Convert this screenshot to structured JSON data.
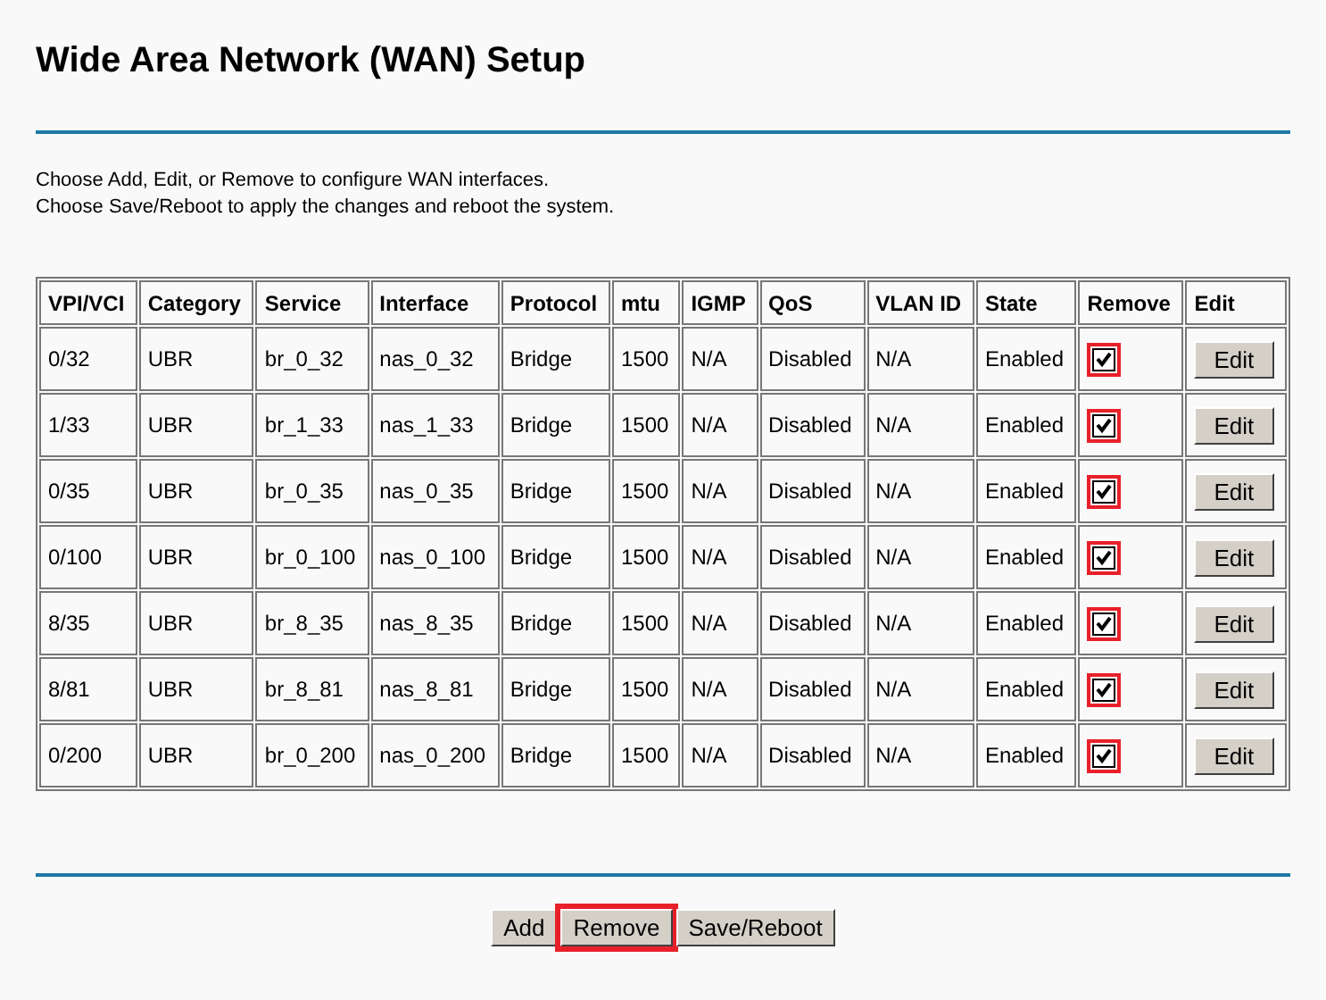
{
  "title": "Wide Area Network (WAN) Setup",
  "instructions": [
    "Choose Add, Edit, or Remove to configure WAN interfaces.",
    "Choose Save/Reboot to apply the changes and reboot the system."
  ],
  "table": {
    "columns": [
      "VPI/VCI",
      "Category",
      "Service",
      "Interface",
      "Protocol",
      "mtu",
      "IGMP",
      "QoS",
      "VLAN ID",
      "State",
      "Remove",
      "Edit"
    ],
    "rows": [
      {
        "cells": [
          "0/32",
          "UBR",
          "br_0_32",
          "nas_0_32",
          "Bridge",
          "1500",
          "N/A",
          "Disabled",
          "N/A",
          "Enabled"
        ],
        "remove_checked": true,
        "remove_highlighted": true,
        "edit_label": "Edit"
      },
      {
        "cells": [
          "1/33",
          "UBR",
          "br_1_33",
          "nas_1_33",
          "Bridge",
          "1500",
          "N/A",
          "Disabled",
          "N/A",
          "Enabled"
        ],
        "remove_checked": true,
        "remove_highlighted": true,
        "edit_label": "Edit"
      },
      {
        "cells": [
          "0/35",
          "UBR",
          "br_0_35",
          "nas_0_35",
          "Bridge",
          "1500",
          "N/A",
          "Disabled",
          "N/A",
          "Enabled"
        ],
        "remove_checked": true,
        "remove_highlighted": true,
        "edit_label": "Edit"
      },
      {
        "cells": [
          "0/100",
          "UBR",
          "br_0_100",
          "nas_0_100",
          "Bridge",
          "1500",
          "N/A",
          "Disabled",
          "N/A",
          "Enabled"
        ],
        "remove_checked": true,
        "remove_highlighted": true,
        "edit_label": "Edit"
      },
      {
        "cells": [
          "8/35",
          "UBR",
          "br_8_35",
          "nas_8_35",
          "Bridge",
          "1500",
          "N/A",
          "Disabled",
          "N/A",
          "Enabled"
        ],
        "remove_checked": true,
        "remove_highlighted": true,
        "edit_label": "Edit"
      },
      {
        "cells": [
          "8/81",
          "UBR",
          "br_8_81",
          "nas_8_81",
          "Bridge",
          "1500",
          "N/A",
          "Disabled",
          "N/A",
          "Enabled"
        ],
        "remove_checked": true,
        "remove_highlighted": true,
        "edit_label": "Edit"
      },
      {
        "cells": [
          "0/200",
          "UBR",
          "br_0_200",
          "nas_0_200",
          "Bridge",
          "1500",
          "N/A",
          "Disabled",
          "N/A",
          "Enabled"
        ],
        "remove_checked": true,
        "remove_highlighted": true,
        "edit_label": "Edit"
      }
    ]
  },
  "buttons": [
    {
      "label": "Add",
      "highlighted": false
    },
    {
      "label": "Remove",
      "highlighted": true
    },
    {
      "label": "Save/Reboot",
      "highlighted": false
    }
  ]
}
